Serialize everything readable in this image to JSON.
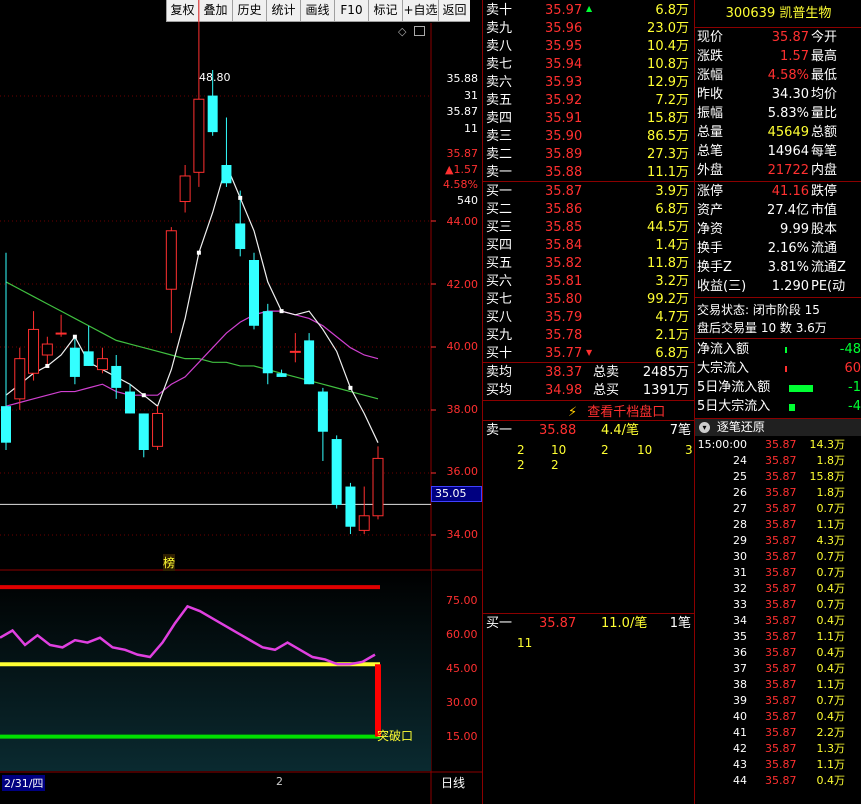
{
  "toolbar": {
    "buttons": [
      "复权",
      "叠加",
      "历史",
      "统计",
      "画线",
      "F10",
      "标记",
      "+自选",
      "返回"
    ]
  },
  "chart": {
    "price_axis": [
      "35.88",
      "31",
      "35.87",
      "11",
      "35.87",
      "▲1.57",
      "4.58%",
      "540",
      "44.00",
      "42.00",
      "40.00",
      "38.00",
      "36.00",
      "35.05",
      "34.00"
    ],
    "max_label": "48.80",
    "marker": "榜",
    "current_price": "35.05",
    "ind_axis": [
      "75.00",
      "60.00",
      "45.00",
      "30.00",
      "15.00"
    ],
    "ind_label": "突破口",
    "date_label": "2/31/四",
    "date_tick": "2",
    "period": "日线"
  },
  "chart_data": {
    "type": "candlestick",
    "y_range": [
      33.5,
      46.5
    ],
    "candles": [
      {
        "o": 37.3,
        "h": 41.5,
        "l": 36.1,
        "c": 36.3
      },
      {
        "o": 37.5,
        "h": 38.9,
        "l": 37.2,
        "c": 38.6
      },
      {
        "o": 38.2,
        "h": 39.9,
        "l": 38,
        "c": 39.4
      },
      {
        "o": 38.7,
        "h": 39.2,
        "l": 38.4,
        "c": 39
      },
      {
        "o": 39.3,
        "h": 39.8,
        "l": 39.2,
        "c": 39.3
      },
      {
        "o": 38.9,
        "h": 39.2,
        "l": 37.9,
        "c": 38.1
      },
      {
        "o": 38.8,
        "h": 39.5,
        "l": 38.4,
        "c": 38.4
      },
      {
        "o": 38.3,
        "h": 38.9,
        "l": 38.2,
        "c": 38.6
      },
      {
        "o": 38.4,
        "h": 38.7,
        "l": 37.5,
        "c": 37.8
      },
      {
        "o": 37.7,
        "h": 37.9,
        "l": 37.1,
        "c": 37.1
      },
      {
        "o": 37.1,
        "h": 37.1,
        "l": 35.9,
        "c": 36.1
      },
      {
        "o": 36.2,
        "h": 37.3,
        "l": 36.1,
        "c": 37.1
      },
      {
        "o": 40.5,
        "h": 42.2,
        "l": 39.3,
        "c": 42.1
      },
      {
        "o": 42.9,
        "h": 43.9,
        "l": 42.6,
        "c": 43.6
      },
      {
        "o": 43.7,
        "h": 48.8,
        "l": 43.3,
        "c": 45.7
      },
      {
        "o": 45.8,
        "h": 46.5,
        "l": 44.7,
        "c": 44.8
      },
      {
        "o": 43.9,
        "h": 45.2,
        "l": 43.3,
        "c": 43.4
      },
      {
        "o": 42.3,
        "h": 43.2,
        "l": 41.4,
        "c": 41.6
      },
      {
        "o": 41.3,
        "h": 41.5,
        "l": 39.4,
        "c": 39.5
      },
      {
        "o": 39.9,
        "h": 40.1,
        "l": 37.9,
        "c": 38.2
      },
      {
        "o": 38.2,
        "h": 38.3,
        "l": 38.1,
        "c": 38.1
      },
      {
        "o": 38.8,
        "h": 39.3,
        "l": 38.5,
        "c": 38.8
      },
      {
        "o": 39.1,
        "h": 39.3,
        "l": 37.9,
        "c": 37.9
      },
      {
        "o": 37.7,
        "h": 37.8,
        "l": 35.8,
        "c": 36.6
      },
      {
        "o": 36.4,
        "h": 36.5,
        "l": 34.5,
        "c": 34.6
      },
      {
        "o": 35.1,
        "h": 35.2,
        "l": 33.8,
        "c": 34
      },
      {
        "o": 33.9,
        "h": 35.1,
        "l": 33.8,
        "c": 34.3
      },
      {
        "o": 34.3,
        "h": 36.2,
        "l": 34.2,
        "c": 35.87
      }
    ],
    "ma_white": [
      37.6,
      37.9,
      38.2,
      38.4,
      38.7,
      39.2,
      38.5,
      38.3,
      38.1,
      37.9,
      37.6,
      37.3,
      38.3,
      39.7,
      41.5,
      42.6,
      43.9,
      43,
      42.1,
      40.7,
      39.9,
      39.8,
      39.9,
      39.4,
      38.8,
      37.8,
      37.1,
      36.3
    ],
    "ma_purple": [
      37.3,
      37.4,
      37.5,
      37.6,
      37.7,
      37.7,
      37.8,
      37.9,
      37.7,
      37.6,
      37.6,
      37.6,
      37.9,
      38.1,
      38.5,
      38.9,
      39.3,
      39.6,
      39.8,
      39.9,
      39.9,
      39.8,
      39.7,
      39.5,
      39.2,
      38.9,
      38.7,
      38.6
    ],
    "ma_green": [
      40.7,
      40.5,
      40.3,
      40.1,
      39.9,
      39.7,
      39.5,
      39.3,
      39.1,
      39,
      38.9,
      38.8,
      38.7,
      38.6,
      38.6,
      38.5,
      38.5,
      38.4,
      38.4,
      38.3,
      38.2,
      38.1,
      38,
      37.9,
      37.8,
      37.7,
      37.6,
      37.5
    ],
    "indicator": {
      "range": [
        5,
        85
      ],
      "upper": 80,
      "middle": 48,
      "lower": 18,
      "line": [
        59,
        62,
        56,
        60,
        56,
        55,
        58,
        57,
        59,
        55,
        54,
        52,
        51,
        57,
        65,
        72,
        70,
        67,
        64,
        61,
        58,
        55,
        54,
        57,
        54,
        51,
        50,
        48,
        48,
        49,
        52
      ]
    }
  },
  "stock": {
    "code": "300639",
    "name": "凯普生物"
  },
  "sell_rows": [
    {
      "label": "卖十",
      "price": "35.97",
      "vol": "6.8万"
    },
    {
      "label": "卖九",
      "price": "35.96",
      "vol": "23.0万"
    },
    {
      "label": "卖八",
      "price": "35.95",
      "vol": "10.4万"
    },
    {
      "label": "卖七",
      "price": "35.94",
      "vol": "10.8万"
    },
    {
      "label": "卖六",
      "price": "35.93",
      "vol": "12.9万"
    },
    {
      "label": "卖五",
      "price": "35.92",
      "vol": "7.2万"
    },
    {
      "label": "卖四",
      "price": "35.91",
      "vol": "15.8万"
    },
    {
      "label": "卖三",
      "price": "35.90",
      "vol": "86.5万"
    },
    {
      "label": "卖二",
      "price": "35.89",
      "vol": "27.3万"
    },
    {
      "label": "卖一",
      "price": "35.88",
      "vol": "11.1万"
    }
  ],
  "buy_rows": [
    {
      "label": "买一",
      "price": "35.87",
      "vol": "3.9万"
    },
    {
      "label": "买二",
      "price": "35.86",
      "vol": "6.8万"
    },
    {
      "label": "买三",
      "price": "35.85",
      "vol": "44.5万"
    },
    {
      "label": "买四",
      "price": "35.84",
      "vol": "1.4万"
    },
    {
      "label": "买五",
      "price": "35.82",
      "vol": "11.8万"
    },
    {
      "label": "买六",
      "price": "35.81",
      "vol": "3.2万"
    },
    {
      "label": "买七",
      "price": "35.80",
      "vol": "99.2万"
    },
    {
      "label": "买八",
      "price": "35.79",
      "vol": "4.7万"
    },
    {
      "label": "买九",
      "price": "35.78",
      "vol": "2.1万"
    },
    {
      "label": "买十",
      "price": "35.77",
      "vol": "6.8万"
    }
  ],
  "summary": [
    {
      "label": "卖均",
      "price": "38.37",
      "k": "总卖",
      "v": "2485万"
    },
    {
      "label": "买均",
      "price": "34.98",
      "k": "总买",
      "v": "1391万"
    }
  ],
  "tenlevel_btn": "查看千档盘口",
  "queue_sell": {
    "label": "卖一",
    "price": "35.88",
    "vol": "4.4/笔",
    "count": "7笔",
    "rows": [
      [
        "2",
        "10",
        "2",
        "10",
        "3"
      ],
      [
        "2",
        "2"
      ]
    ]
  },
  "queue_buy": {
    "label": "买一",
    "price": "35.87",
    "vol": "11.0/笔",
    "count": "1笔",
    "rows": [
      [
        "11"
      ]
    ]
  },
  "quote": [
    {
      "l": "现价",
      "v": "35.87",
      "c": "red",
      "r": "今开"
    },
    {
      "l": "涨跌",
      "v": "1.57",
      "c": "red",
      "r": "最高"
    },
    {
      "l": "涨幅",
      "v": "4.58%",
      "c": "red",
      "r": "最低"
    },
    {
      "l": "昨收",
      "v": "34.30",
      "c": "wht",
      "r": "均价"
    },
    {
      "l": "振幅",
      "v": "5.83%",
      "c": "wht",
      "r": "量比"
    },
    {
      "l": "总量",
      "v": "45649",
      "c": "yel",
      "r": "总额"
    },
    {
      "l": "总笔",
      "v": "14964",
      "c": "wht",
      "r": "每笔"
    },
    {
      "l": "外盘",
      "v": "21722",
      "c": "red",
      "r": "内盘"
    }
  ],
  "fund": [
    {
      "l": "涨停",
      "v": "41.16",
      "c": "red",
      "r": "跌停"
    },
    {
      "l": "资产",
      "v": "27.4亿",
      "c": "wht",
      "r": "市值"
    },
    {
      "l": "净资",
      "v": "9.99",
      "c": "wht",
      "r": "股本"
    },
    {
      "l": "换手",
      "v": "2.16%",
      "c": "wht",
      "r": "流通"
    },
    {
      "l": "换手Z",
      "v": "3.81%",
      "c": "wht",
      "r": "流通Z"
    },
    {
      "l": "收益(三)",
      "v": "1.290",
      "c": "wht",
      "r": "PE(动"
    }
  ],
  "status": {
    "trade_state": "交易状态: 闭市阶段 15",
    "after_vol": "盘后交易量 10 数 3.6万"
  },
  "flows": [
    {
      "l": "净流入额",
      "v": "-48"
    },
    {
      "l": "大宗流入",
      "v": "60"
    },
    {
      "l": "5日净流入额",
      "v": "-1"
    },
    {
      "l": "5日大宗流入",
      "v": "-4"
    }
  ],
  "trades_title": "逐笔还原",
  "trades": [
    {
      "t": "15:00:00",
      "p": "35.87",
      "v": "14.3万"
    },
    {
      "t": "24",
      "p": "35.87",
      "v": "1.8万"
    },
    {
      "t": "25",
      "p": "35.87",
      "v": "15.8万"
    },
    {
      "t": "26",
      "p": "35.87",
      "v": "1.8万"
    },
    {
      "t": "27",
      "p": "35.87",
      "v": "0.7万"
    },
    {
      "t": "28",
      "p": "35.87",
      "v": "1.1万"
    },
    {
      "t": "29",
      "p": "35.87",
      "v": "4.3万"
    },
    {
      "t": "30",
      "p": "35.87",
      "v": "0.7万"
    },
    {
      "t": "31",
      "p": "35.87",
      "v": "0.7万"
    },
    {
      "t": "32",
      "p": "35.87",
      "v": "0.4万"
    },
    {
      "t": "33",
      "p": "35.87",
      "v": "0.7万"
    },
    {
      "t": "34",
      "p": "35.87",
      "v": "0.4万"
    },
    {
      "t": "35",
      "p": "35.87",
      "v": "1.1万"
    },
    {
      "t": "36",
      "p": "35.87",
      "v": "0.4万"
    },
    {
      "t": "37",
      "p": "35.87",
      "v": "0.4万"
    },
    {
      "t": "38",
      "p": "35.87",
      "v": "1.1万"
    },
    {
      "t": "39",
      "p": "35.87",
      "v": "0.7万"
    },
    {
      "t": "40",
      "p": "35.87",
      "v": "0.4万"
    },
    {
      "t": "41",
      "p": "35.87",
      "v": "2.2万"
    },
    {
      "t": "42",
      "p": "35.87",
      "v": "1.3万"
    },
    {
      "t": "43",
      "p": "35.87",
      "v": "1.1万"
    },
    {
      "t": "44",
      "p": "35.87",
      "v": "0.4万"
    }
  ]
}
